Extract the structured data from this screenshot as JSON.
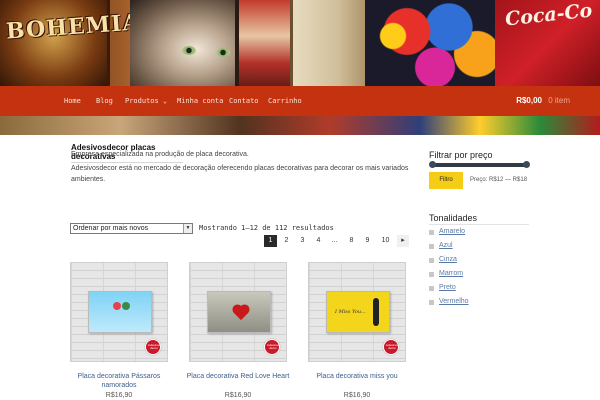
{
  "banner": {
    "bohemia_text": "BOHEMIA",
    "coke_text": "Coca-Co"
  },
  "nav": {
    "items": [
      {
        "label": "Home"
      },
      {
        "label": "Blog"
      },
      {
        "label": "Produtos ⌄"
      },
      {
        "label": "Minha conta"
      },
      {
        "label": "Contato"
      },
      {
        "label": "Carrinho"
      }
    ],
    "cart_total": "R$0,00",
    "cart_items": "0 item"
  },
  "page": {
    "title": "Adesivosdecor placas decorativas",
    "desc_1": "Empresa especializada na produção de placa decorativa.",
    "desc_2": "Adesivosdecor está no mercado de decoração oferecendo placas decorativas para decorar os mais variados ambientes."
  },
  "shop": {
    "ordering_selected": "Ordenar por mais novos",
    "result_count": "Mostrando 1–12 de 112 resultados",
    "pagination": [
      "1",
      "2",
      "3",
      "4",
      "…",
      "8",
      "9",
      "10",
      "▸"
    ],
    "current_page": "1"
  },
  "products": [
    {
      "name": "Placa decorativa Pássaros namorados",
      "price": "R$16,90",
      "art_text": ""
    },
    {
      "name": "Placa decorativa Red Love Heart",
      "price": "R$16,90",
      "art_text": ""
    },
    {
      "name": "Placa decorativa miss you",
      "price": "R$16,90",
      "art_text": "I Miss You..."
    }
  ],
  "seal_text": "Adesivos decor",
  "sidebar": {
    "price_filter_title": "Filtrar por preço",
    "filter_button": "Filtro",
    "price_range": "Preço: R$12 — R$18",
    "tones_title": "Tonalidades",
    "tones": [
      "Amarelo",
      "Azul",
      "Cinza",
      "Marrom",
      "Preto",
      "Vermelho"
    ]
  },
  "colors": {
    "nav_bar": "#c4320f",
    "filter_button": "#f5cd16",
    "link": "#3d5f8a",
    "active_page": "#2a2a2a"
  }
}
